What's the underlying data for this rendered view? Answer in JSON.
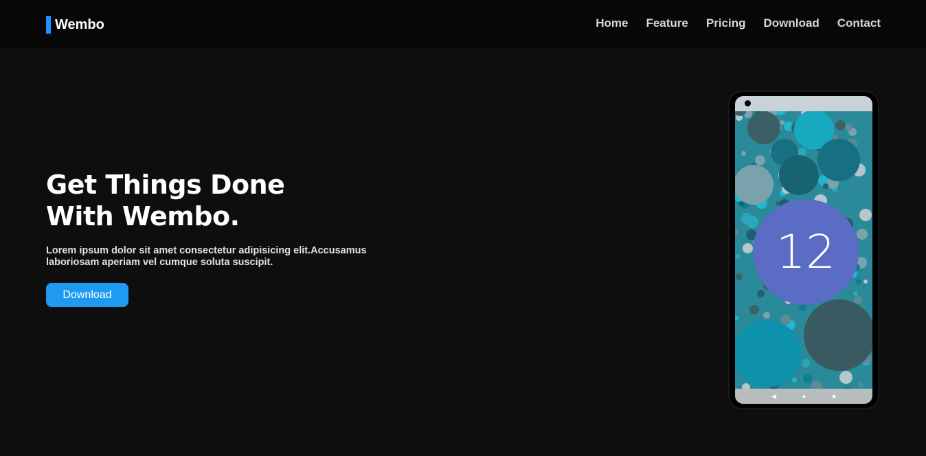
{
  "brand": {
    "name": "Wembo",
    "accent": "#1e90ff"
  },
  "nav": {
    "items": [
      "Home",
      "Feature",
      "Pricing",
      "Download",
      "Contact"
    ]
  },
  "hero": {
    "title_line1": "Get Things Done",
    "title_line2": "With Wembo.",
    "description": "Lorem ipsum dolor sit amet consectetur adipisicing elit.Accusamus laboriosam aperiam vel cumque soluta suscipit.",
    "button_label": "Download",
    "button_color": "#1e9bf0"
  },
  "phone": {
    "version_label": "12",
    "nav_icons": [
      "back-icon",
      "home-icon",
      "recents-icon"
    ]
  }
}
